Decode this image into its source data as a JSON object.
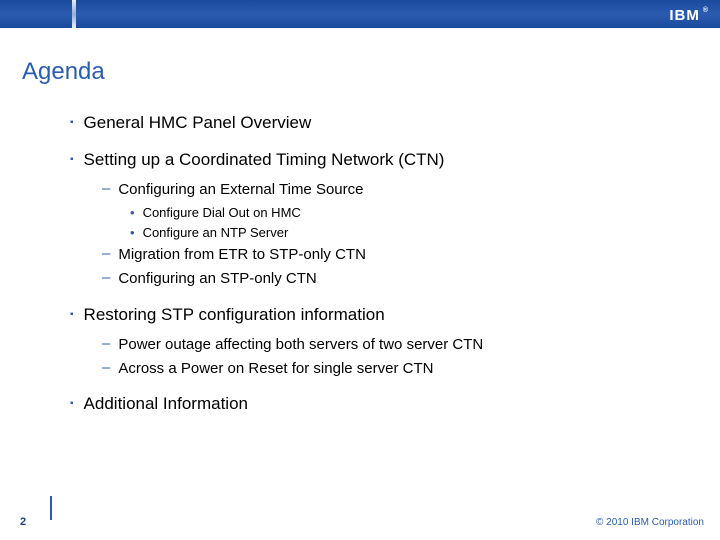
{
  "header": {
    "logo_text": "IBM"
  },
  "title": "Agenda",
  "bullets": [
    {
      "text": "General HMC Panel Overview"
    },
    {
      "text": "Setting up a Coordinated Timing Network (CTN)",
      "children": [
        {
          "text": "Configuring an External Time Source",
          "children": [
            {
              "text": "Configure Dial Out on HMC"
            },
            {
              "text": "Configure an NTP Server"
            }
          ]
        },
        {
          "text": "Migration from ETR to STP-only CTN"
        },
        {
          "text": "Configuring an STP-only CTN"
        }
      ]
    },
    {
      "text": "Restoring STP configuration information",
      "children": [
        {
          "text": "Power outage affecting both servers of two server CTN"
        },
        {
          "text": "Across a Power on Reset for single server CTN"
        }
      ]
    },
    {
      "text": "Additional Information"
    }
  ],
  "footer": {
    "page_number": "2",
    "copyright": "© 2010 IBM Corporation"
  }
}
